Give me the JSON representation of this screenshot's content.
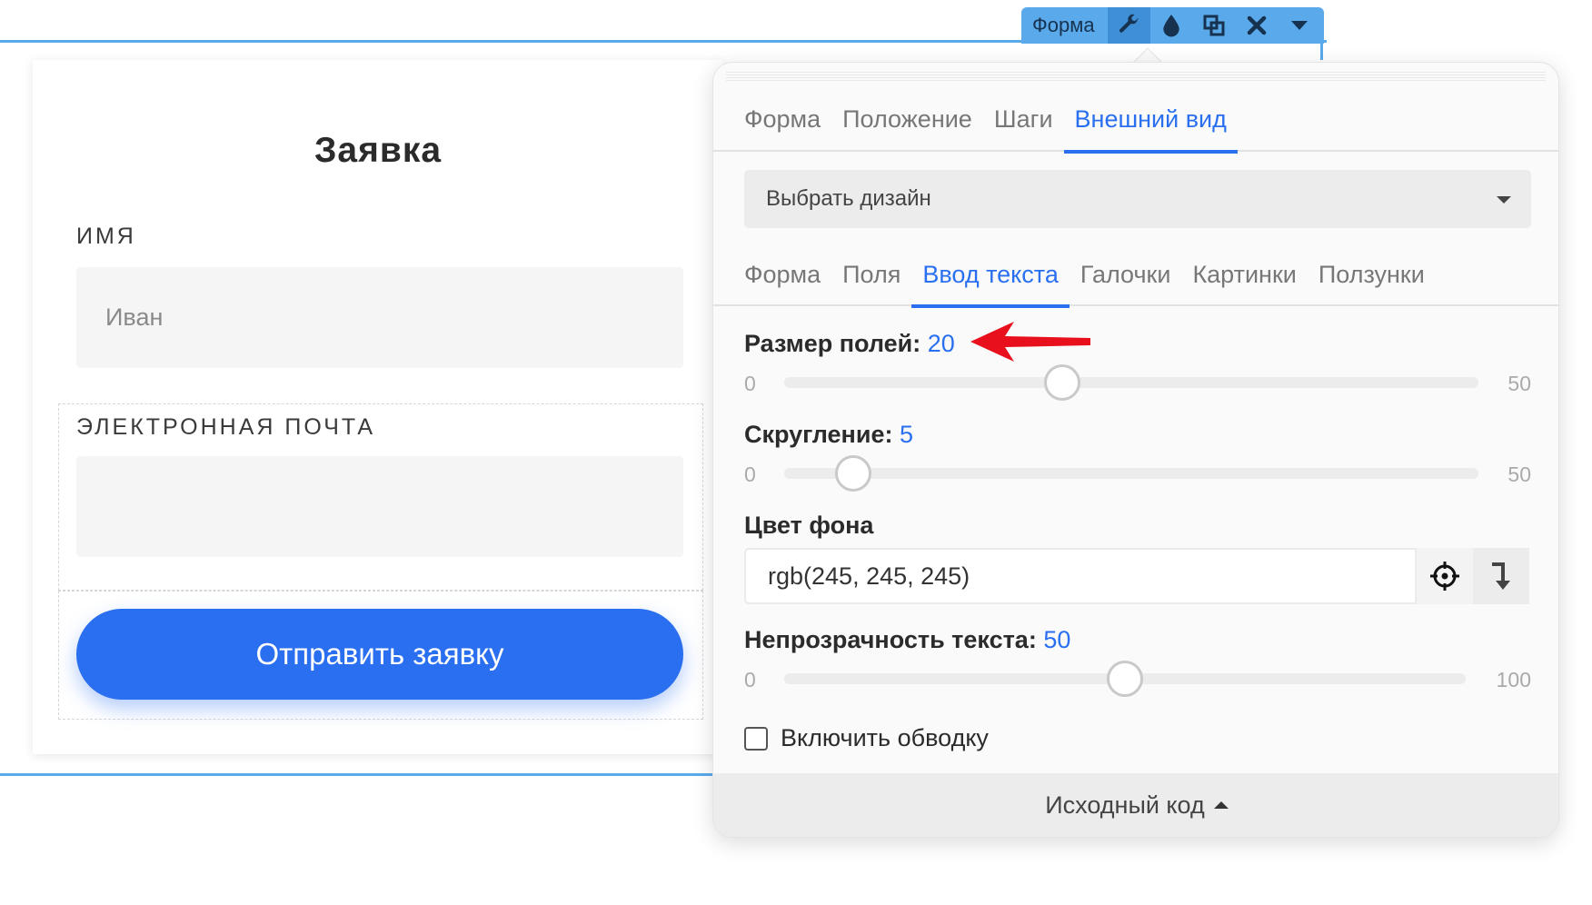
{
  "toolbar": {
    "label": "Форма",
    "buttons": [
      "wrench-icon",
      "drop-icon",
      "copy-icon",
      "close-icon",
      "chevron-down-icon"
    ]
  },
  "form": {
    "title": "Заявка",
    "name_label": "ИМЯ",
    "name_value": "Иван",
    "email_label": "ЭЛЕКТРОННАЯ ПОЧТА",
    "email_value": "",
    "submit_label": "Отправить заявку"
  },
  "panel": {
    "main_tabs": [
      {
        "label": "Форма",
        "active": false
      },
      {
        "label": "Положение",
        "active": false
      },
      {
        "label": "Шаги",
        "active": false
      },
      {
        "label": "Внешний вид",
        "active": true
      }
    ],
    "design_select": "Выбрать дизайн",
    "sub_tabs": [
      {
        "label": "Форма",
        "active": false
      },
      {
        "label": "Поля",
        "active": false
      },
      {
        "label": "Ввод текста",
        "active": true
      },
      {
        "label": "Галочки",
        "active": false
      },
      {
        "label": "Картинки",
        "active": false
      },
      {
        "label": "Ползунки",
        "active": false
      }
    ],
    "field_size": {
      "label": "Размер полей:",
      "value": "20",
      "min": "0",
      "max": "50",
      "level": 0.4
    },
    "rounding": {
      "label": "Скругление:",
      "value": "5",
      "min": "0",
      "max": "50",
      "level": 0.1
    },
    "bg_color": {
      "label": "Цвет фона",
      "value": "rgb(245, 245, 245)"
    },
    "text_opacity": {
      "label": "Непрозрачность текста:",
      "value": "50",
      "min": "0",
      "max": "100",
      "level": 0.5
    },
    "outline_checkbox": {
      "label": "Включить обводку",
      "checked": false
    },
    "source_code": "Исходный код"
  },
  "colors": {
    "accent": "#2a6ff0",
    "selection": "#5aa9ea",
    "annotation_arrow": "#e8101c"
  }
}
